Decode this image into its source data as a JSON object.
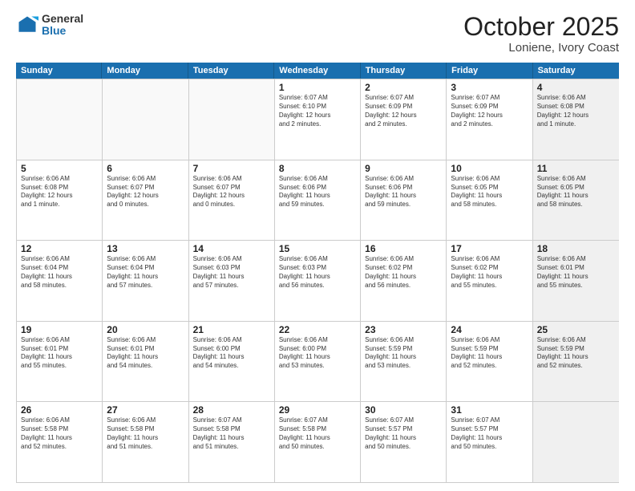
{
  "logo": {
    "general": "General",
    "blue": "Blue"
  },
  "header": {
    "month": "October 2025",
    "location": "Loniene, Ivory Coast"
  },
  "days": [
    "Sunday",
    "Monday",
    "Tuesday",
    "Wednesday",
    "Thursday",
    "Friday",
    "Saturday"
  ],
  "rows": [
    [
      {
        "day": "",
        "info": "",
        "empty": true
      },
      {
        "day": "",
        "info": "",
        "empty": true
      },
      {
        "day": "",
        "info": "",
        "empty": true
      },
      {
        "day": "1",
        "info": "Sunrise: 6:07 AM\nSunset: 6:10 PM\nDaylight: 12 hours\nand 2 minutes.",
        "empty": false
      },
      {
        "day": "2",
        "info": "Sunrise: 6:07 AM\nSunset: 6:09 PM\nDaylight: 12 hours\nand 2 minutes.",
        "empty": false
      },
      {
        "day": "3",
        "info": "Sunrise: 6:07 AM\nSunset: 6:09 PM\nDaylight: 12 hours\nand 2 minutes.",
        "empty": false
      },
      {
        "day": "4",
        "info": "Sunrise: 6:06 AM\nSunset: 6:08 PM\nDaylight: 12 hours\nand 1 minute.",
        "empty": false,
        "shaded": true
      }
    ],
    [
      {
        "day": "5",
        "info": "Sunrise: 6:06 AM\nSunset: 6:08 PM\nDaylight: 12 hours\nand 1 minute.",
        "empty": false
      },
      {
        "day": "6",
        "info": "Sunrise: 6:06 AM\nSunset: 6:07 PM\nDaylight: 12 hours\nand 0 minutes.",
        "empty": false
      },
      {
        "day": "7",
        "info": "Sunrise: 6:06 AM\nSunset: 6:07 PM\nDaylight: 12 hours\nand 0 minutes.",
        "empty": false
      },
      {
        "day": "8",
        "info": "Sunrise: 6:06 AM\nSunset: 6:06 PM\nDaylight: 11 hours\nand 59 minutes.",
        "empty": false
      },
      {
        "day": "9",
        "info": "Sunrise: 6:06 AM\nSunset: 6:06 PM\nDaylight: 11 hours\nand 59 minutes.",
        "empty": false
      },
      {
        "day": "10",
        "info": "Sunrise: 6:06 AM\nSunset: 6:05 PM\nDaylight: 11 hours\nand 58 minutes.",
        "empty": false
      },
      {
        "day": "11",
        "info": "Sunrise: 6:06 AM\nSunset: 6:05 PM\nDaylight: 11 hours\nand 58 minutes.",
        "empty": false,
        "shaded": true
      }
    ],
    [
      {
        "day": "12",
        "info": "Sunrise: 6:06 AM\nSunset: 6:04 PM\nDaylight: 11 hours\nand 58 minutes.",
        "empty": false
      },
      {
        "day": "13",
        "info": "Sunrise: 6:06 AM\nSunset: 6:04 PM\nDaylight: 11 hours\nand 57 minutes.",
        "empty": false
      },
      {
        "day": "14",
        "info": "Sunrise: 6:06 AM\nSunset: 6:03 PM\nDaylight: 11 hours\nand 57 minutes.",
        "empty": false
      },
      {
        "day": "15",
        "info": "Sunrise: 6:06 AM\nSunset: 6:03 PM\nDaylight: 11 hours\nand 56 minutes.",
        "empty": false
      },
      {
        "day": "16",
        "info": "Sunrise: 6:06 AM\nSunset: 6:02 PM\nDaylight: 11 hours\nand 56 minutes.",
        "empty": false
      },
      {
        "day": "17",
        "info": "Sunrise: 6:06 AM\nSunset: 6:02 PM\nDaylight: 11 hours\nand 55 minutes.",
        "empty": false
      },
      {
        "day": "18",
        "info": "Sunrise: 6:06 AM\nSunset: 6:01 PM\nDaylight: 11 hours\nand 55 minutes.",
        "empty": false,
        "shaded": true
      }
    ],
    [
      {
        "day": "19",
        "info": "Sunrise: 6:06 AM\nSunset: 6:01 PM\nDaylight: 11 hours\nand 55 minutes.",
        "empty": false
      },
      {
        "day": "20",
        "info": "Sunrise: 6:06 AM\nSunset: 6:01 PM\nDaylight: 11 hours\nand 54 minutes.",
        "empty": false
      },
      {
        "day": "21",
        "info": "Sunrise: 6:06 AM\nSunset: 6:00 PM\nDaylight: 11 hours\nand 54 minutes.",
        "empty": false
      },
      {
        "day": "22",
        "info": "Sunrise: 6:06 AM\nSunset: 6:00 PM\nDaylight: 11 hours\nand 53 minutes.",
        "empty": false
      },
      {
        "day": "23",
        "info": "Sunrise: 6:06 AM\nSunset: 5:59 PM\nDaylight: 11 hours\nand 53 minutes.",
        "empty": false
      },
      {
        "day": "24",
        "info": "Sunrise: 6:06 AM\nSunset: 5:59 PM\nDaylight: 11 hours\nand 52 minutes.",
        "empty": false
      },
      {
        "day": "25",
        "info": "Sunrise: 6:06 AM\nSunset: 5:59 PM\nDaylight: 11 hours\nand 52 minutes.",
        "empty": false,
        "shaded": true
      }
    ],
    [
      {
        "day": "26",
        "info": "Sunrise: 6:06 AM\nSunset: 5:58 PM\nDaylight: 11 hours\nand 52 minutes.",
        "empty": false
      },
      {
        "day": "27",
        "info": "Sunrise: 6:06 AM\nSunset: 5:58 PM\nDaylight: 11 hours\nand 51 minutes.",
        "empty": false
      },
      {
        "day": "28",
        "info": "Sunrise: 6:07 AM\nSunset: 5:58 PM\nDaylight: 11 hours\nand 51 minutes.",
        "empty": false
      },
      {
        "day": "29",
        "info": "Sunrise: 6:07 AM\nSunset: 5:58 PM\nDaylight: 11 hours\nand 50 minutes.",
        "empty": false
      },
      {
        "day": "30",
        "info": "Sunrise: 6:07 AM\nSunset: 5:57 PM\nDaylight: 11 hours\nand 50 minutes.",
        "empty": false
      },
      {
        "day": "31",
        "info": "Sunrise: 6:07 AM\nSunset: 5:57 PM\nDaylight: 11 hours\nand 50 minutes.",
        "empty": false
      },
      {
        "day": "",
        "info": "",
        "empty": true,
        "shaded": true
      }
    ]
  ]
}
